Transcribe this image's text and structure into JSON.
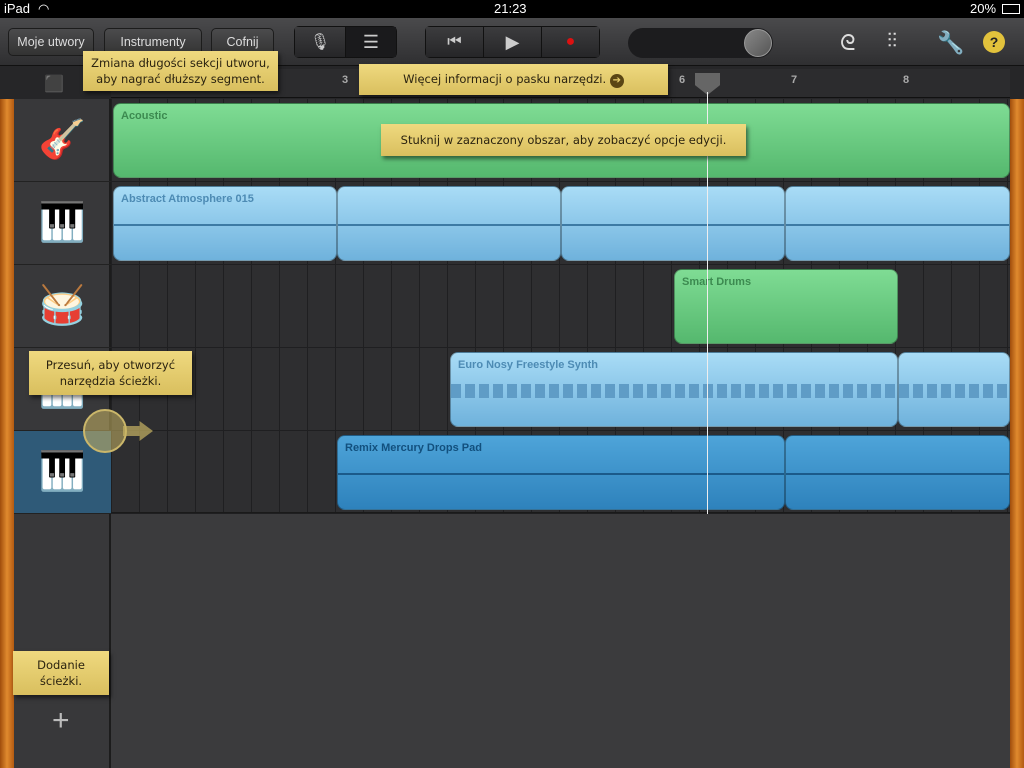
{
  "status": {
    "device": "iPad",
    "time": "21:23",
    "battery": "20%"
  },
  "toolbar": {
    "my_songs": "Moje utwory",
    "instruments": "Instrumenty",
    "undo": "Cofnij",
    "help": "?"
  },
  "ruler": {
    "bars": [
      "3",
      "6",
      "7",
      "8"
    ]
  },
  "tracks": [
    {
      "instrument": "acoustic-guitar",
      "regions": [
        {
          "name": "Acoustic"
        }
      ]
    },
    {
      "instrument": "keyboard",
      "regions": [
        {
          "name": "Abstract Atmosphere 015"
        },
        {
          "name": ""
        },
        {
          "name": ""
        },
        {
          "name": ""
        }
      ]
    },
    {
      "instrument": "drum-machine",
      "regions": [
        {
          "name": "Smart Drums"
        }
      ]
    },
    {
      "instrument": "synth",
      "regions": [
        {
          "name": "Euro Nosy Freestyle Synth"
        },
        {
          "name": ""
        }
      ]
    },
    {
      "instrument": "keyboard",
      "regions": [
        {
          "name": "Remix Mercury Drops Pad"
        },
        {
          "name": ""
        }
      ]
    }
  ],
  "tips": {
    "section_length": "Zmiana długości sekcji utworu, aby nagrać dłuższy segment.",
    "toolbar_info": "Więcej informacji o pasku narzędzi.",
    "edit_options": "Stuknij w zaznaczony obszar, aby zobaczyć opcje edycji.",
    "swipe_tools": "Przesuń, aby otworzyć narzędzia ścieżki.",
    "add_track": "Dodanie ścieżki."
  },
  "colors": {
    "green": "#6ccc84",
    "light_blue": "#8ccbee",
    "dark_blue": "#3a92cc",
    "note": "#e6cd6e"
  }
}
